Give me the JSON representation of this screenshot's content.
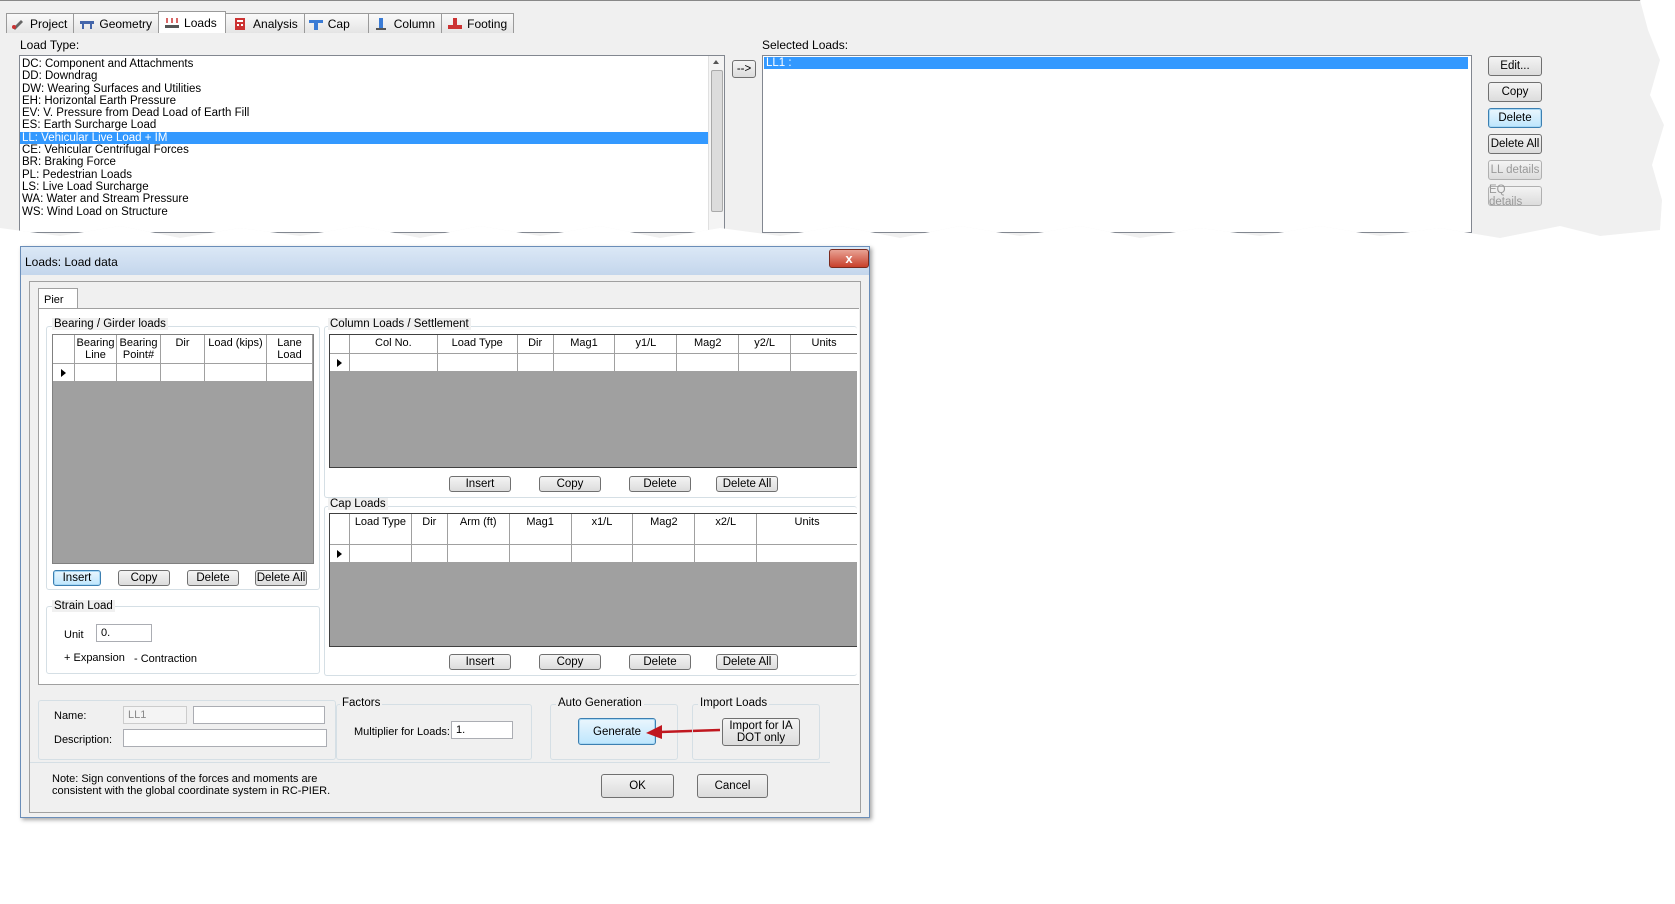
{
  "tabs": [
    {
      "label": "Project",
      "icon": "project-icon"
    },
    {
      "label": "Geometry",
      "icon": "geometry-icon"
    },
    {
      "label": "Loads",
      "icon": "loads-icon",
      "active": true
    },
    {
      "label": "Analysis",
      "icon": "analysis-icon"
    },
    {
      "label": "Cap",
      "icon": "cap-icon"
    },
    {
      "label": "Column",
      "icon": "column-icon"
    },
    {
      "label": "Footing",
      "icon": "footing-icon"
    }
  ],
  "load_type": {
    "label": "Load Type:",
    "items": [
      "DC: Component and Attachments",
      "DD: Downdrag",
      "DW: Wearing Surfaces and Utilities",
      "EH: Horizontal Earth Pressure",
      "EV: V. Pressure from Dead Load of Earth Fill",
      "ES: Earth Surcharge Load",
      "LL: Vehicular Live Load + IM",
      "CE: Vehicular Centrifugal Forces",
      "BR: Braking Force",
      "PL: Pedestrian Loads",
      "LS: Live Load Surcharge",
      "WA: Water and Stream Pressure",
      "WS: Wind Load on Structure"
    ],
    "selected_index": 6
  },
  "arrow_button": "-->",
  "selected_loads": {
    "label": "Selected Loads:",
    "items": [
      "LL1       :"
    ]
  },
  "side_buttons": [
    "Edit...",
    "Copy",
    "Delete",
    "Delete All",
    "LL details",
    "EQ details"
  ],
  "dialog": {
    "title": "Loads: Load data",
    "close": "x",
    "tab": "Pier",
    "bearing": {
      "title": "Bearing / Girder loads",
      "columns": [
        "Bearing Line",
        "Bearing Point#",
        "Dir",
        "Load (kips)",
        "Lane Load"
      ],
      "buttons": [
        "Insert",
        "Copy",
        "Delete",
        "Delete All"
      ]
    },
    "column_loads": {
      "title": "Column Loads / Settlement",
      "columns": [
        "Col No.",
        "Load Type",
        "Dir",
        "Mag1",
        "y1/L",
        "Mag2",
        "y2/L",
        "Units"
      ],
      "buttons": [
        "Insert",
        "Copy",
        "Delete",
        "Delete All"
      ]
    },
    "cap_loads": {
      "title": "Cap Loads",
      "columns": [
        "Load Type",
        "Dir",
        "Arm (ft)",
        "Mag1",
        "x1/L",
        "Mag2",
        "x2/L",
        "Units"
      ],
      "buttons": [
        "Insert",
        "Copy",
        "Delete",
        "Delete All"
      ]
    },
    "strain": {
      "title": "Strain Load",
      "unit_label": "Unit",
      "unit_value": "0.",
      "expansion": "+ Expansion",
      "contraction": "- Contraction"
    },
    "name_label": "Name:",
    "name_value": "LL1",
    "description_label": "Description:",
    "factors": {
      "title": "Factors",
      "multiplier_label": "Multiplier for Loads:",
      "multiplier_value": "1."
    },
    "auto_generation": {
      "title": "Auto Generation",
      "button": "Generate"
    },
    "import_loads": {
      "title": "Import Loads",
      "button": "Import for IA DOT only"
    },
    "note": "Note: Sign conventions of the forces and moments are consistent with the global coordinate system in RC-PIER.",
    "ok": "OK",
    "cancel": "Cancel"
  },
  "colors": {
    "selection": "#3399ff",
    "arrow": "#c0171f"
  }
}
